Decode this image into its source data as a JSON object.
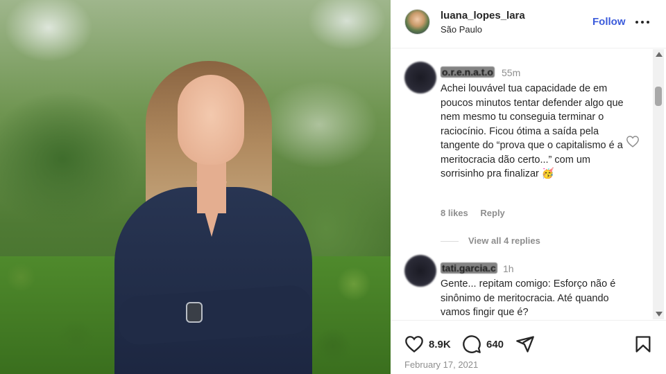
{
  "post": {
    "username": "luana_lopes_lara",
    "location": "São Paulo",
    "follow_label": "Follow",
    "date": "February 17, 2021"
  },
  "comments": [
    {
      "username": "o.r.e.n.a.t.o",
      "time": "55m",
      "text": "Achei louvável tua capacidade de em poucos minutos tentar defender algo que nem mesmo tu conseguia terminar o raciocínio. Ficou ótima a saída pela tangente do “prova que o capitalismo é a meritocracia dão certo...” com um sorrisinho pra finalizar 🥳",
      "likes": "8 likes",
      "reply_label": "Reply",
      "view_replies": "View all 4 replies"
    },
    {
      "username": "tati.garcia.c",
      "time": "1h",
      "text": "Gente... repitam comigo: Esforço não é sinônimo de meritocracia. Até quando vamos fingir que é?"
    }
  ],
  "actions": {
    "likes_count": "8.9K",
    "comments_count": "640"
  },
  "icons": {
    "like": "heart-icon",
    "comment": "comment-icon",
    "share": "share-icon",
    "save": "bookmark-icon",
    "more": "more-options-icon",
    "comment_like": "heart-outline-icon"
  },
  "colors": {
    "follow": "#3b5bdb",
    "muted": "#8e8e8e",
    "text": "#262626"
  }
}
